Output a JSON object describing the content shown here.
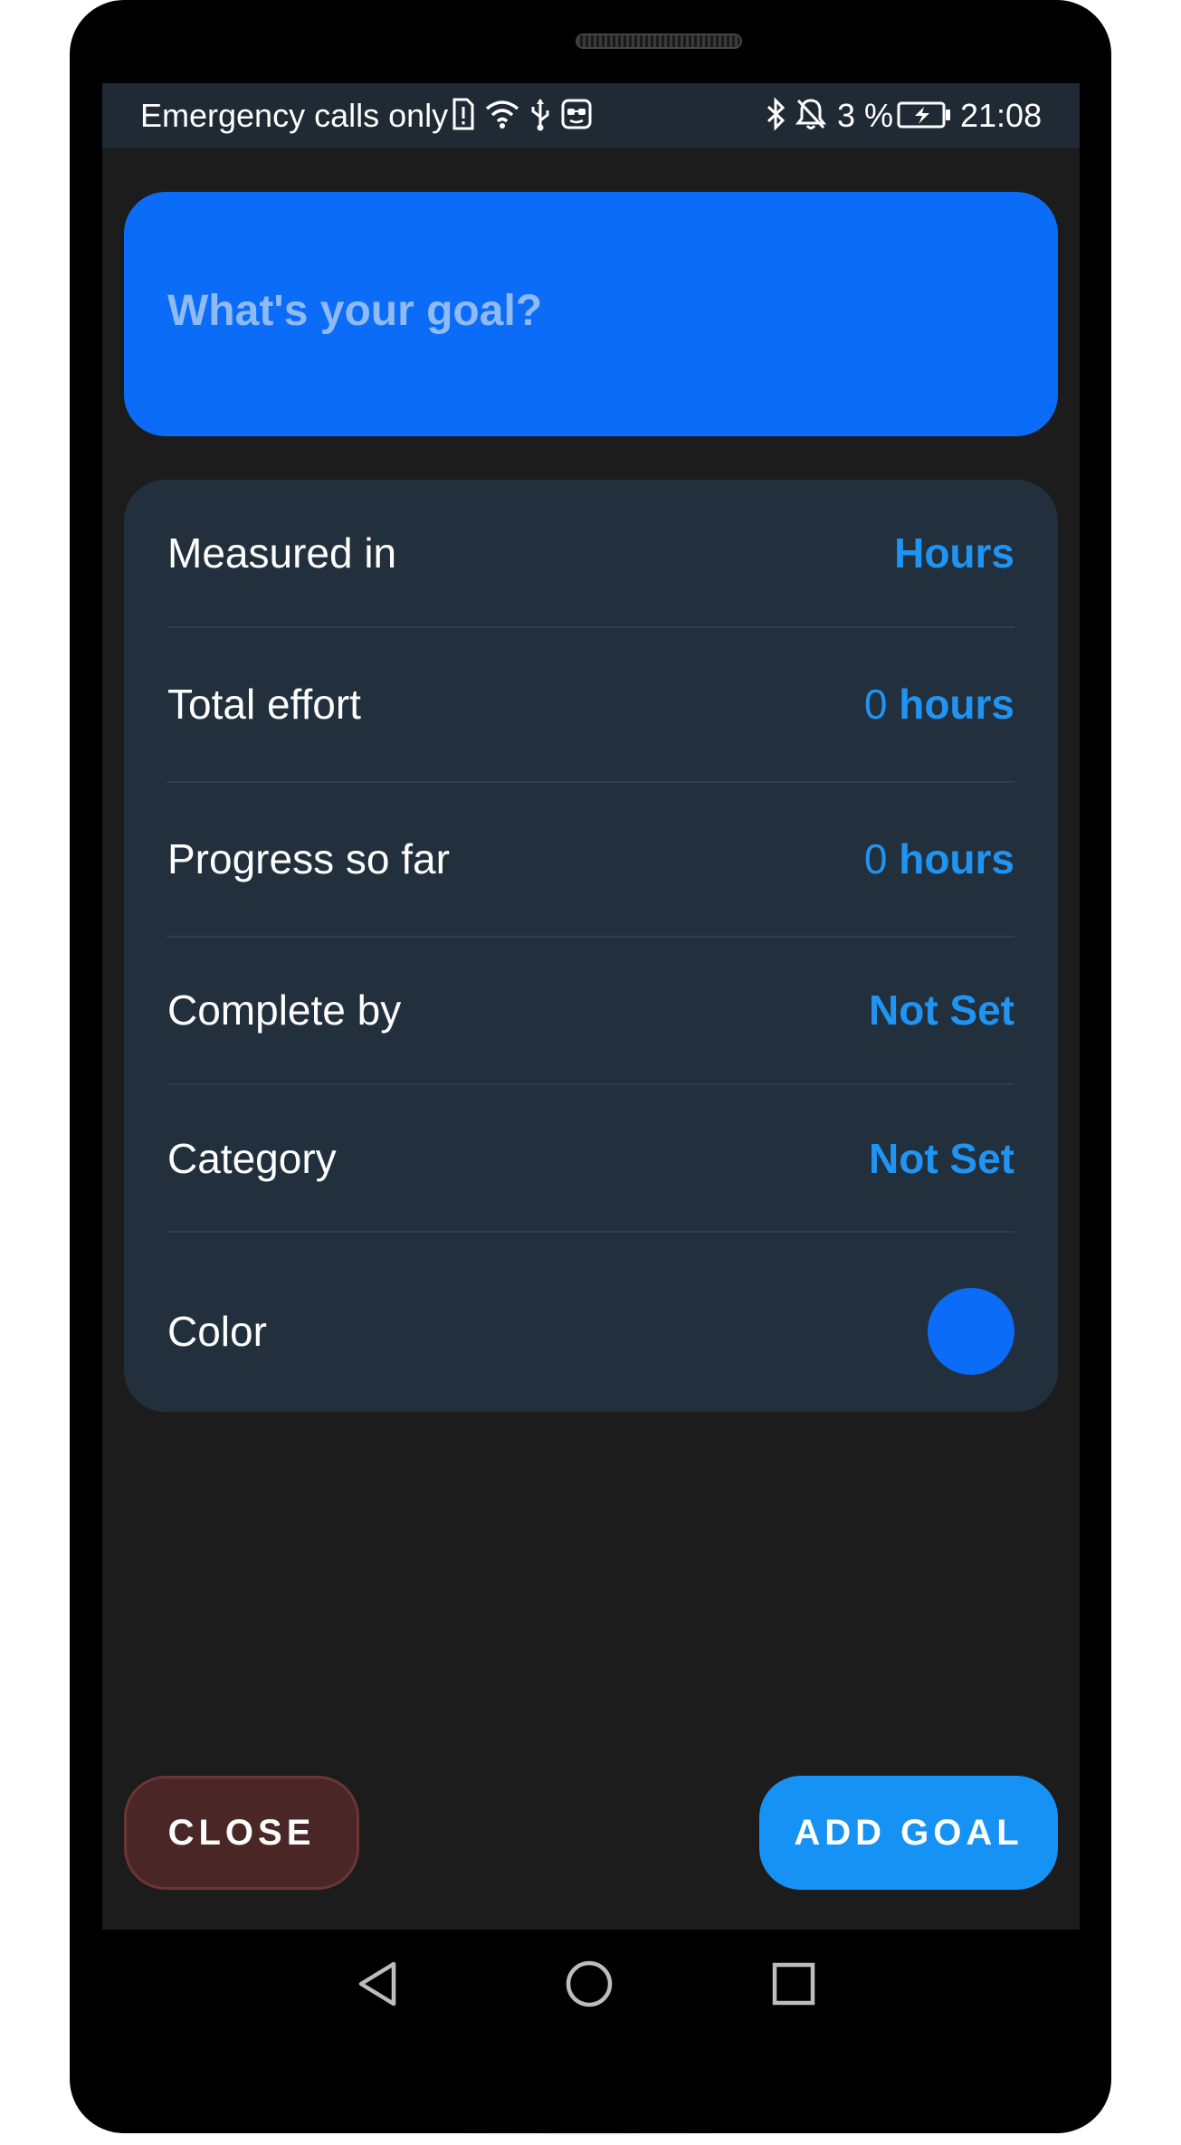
{
  "status_bar": {
    "carrier_text": "Emergency calls only",
    "left_icons": [
      "sim-alert-icon",
      "wifi-icon",
      "usb-icon",
      "app-notification-icon"
    ],
    "right_icons": [
      "bluetooth-icon",
      "notifications-off-icon"
    ],
    "battery_percent": "3 %",
    "battery_icon": "battery-charging-icon",
    "time": "21:08"
  },
  "goal": {
    "placeholder": "What's your goal?",
    "value": ""
  },
  "settings": {
    "measured_in": {
      "label": "Measured in",
      "value": "Hours"
    },
    "total_effort": {
      "label": "Total effort",
      "number": "0",
      "unit": "hours"
    },
    "progress": {
      "label": "Progress so far",
      "number": "0",
      "unit": "hours"
    },
    "complete_by": {
      "label": "Complete by",
      "value": "Not Set"
    },
    "category": {
      "label": "Category",
      "value": "Not Set"
    },
    "color": {
      "label": "Color",
      "value": "#0A6CF7"
    }
  },
  "buttons": {
    "close": "CLOSE",
    "add_goal": "ADD GOAL"
  },
  "nav": {
    "back_icon": "back-triangle-icon",
    "home_icon": "home-circle-icon",
    "recents_icon": "recents-square-icon"
  },
  "colors": {
    "accent": "#0A6CF7",
    "value_text": "#1F94F2",
    "card_bg": "#22303D",
    "screen_bg": "#1C1C1C",
    "close_bg": "#4A2626",
    "add_bg": "#1692F5"
  }
}
